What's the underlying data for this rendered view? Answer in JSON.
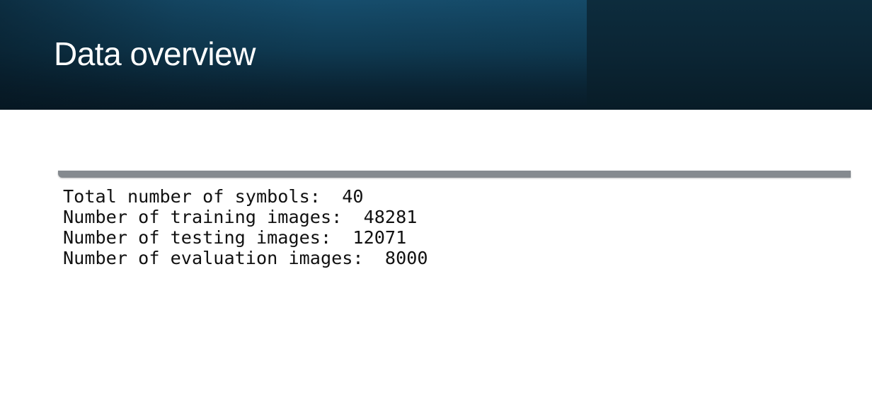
{
  "slide": {
    "title": "Data overview"
  },
  "output": {
    "lines": [
      "Total number of symbols:  40",
      "Number of training images:  48281",
      "Number of testing images:  12071",
      "Number of evaluation images:  8000"
    ]
  },
  "colors": {
    "header_dark": "#081b27",
    "header_blue": "#164d6c",
    "console_bar": "#858a8f",
    "text": "#111111"
  }
}
